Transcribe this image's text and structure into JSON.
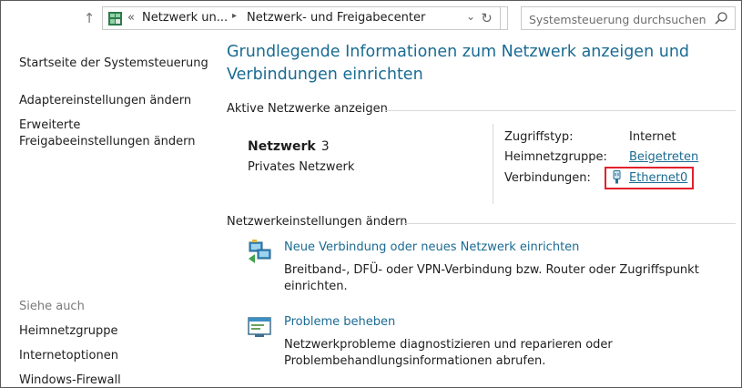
{
  "window": {
    "title": "Netzwerk- und Freigabecenter"
  },
  "nav": {
    "up_glyph": "↑"
  },
  "address_bar": {
    "overflow": "«",
    "crumbs": [
      "Netzwerk un...",
      "Netzwerk- und Freigabecenter"
    ],
    "separator": "▸",
    "dropdown_glyph": "⌄",
    "refresh_glyph": "↻"
  },
  "search": {
    "placeholder": "Systemsteuerung durchsuchen"
  },
  "sidebar": {
    "home": "Startseite der Systemsteuerung",
    "adapter": "Adaptereinstellungen ändern",
    "advanced_line1": "Erweiterte",
    "advanced_line2": "Freigabeeinstellungen ändern",
    "see_also": "Siehe auch",
    "links": [
      "Heimnetzgruppe",
      "Internetoptionen",
      "Windows-Firewall"
    ]
  },
  "main": {
    "title_line1": "Grundlegende Informationen zum Netzwerk anzeigen und",
    "title_line2": "Verbindungen einrichten",
    "active_networks_header": "Aktive Netzwerke anzeigen",
    "network": {
      "name": "Netzwerk",
      "number": "3",
      "type": "Privates Netzwerk",
      "access_type_label": "Zugriffstyp:",
      "access_type_value": "Internet",
      "homegroup_label": "Heimnetzgruppe:",
      "homegroup_value": "Beigetreten",
      "connections_label": "Verbindungen:",
      "connections_value": "Ethernet0"
    },
    "change_settings_header": "Netzwerkeinstellungen ändern",
    "tasks": [
      {
        "link": "Neue Verbindung oder neues Netzwerk einrichten",
        "desc_line1": "Breitband-, DFÜ- oder VPN-Verbindung bzw. Router oder Zugriffspunkt",
        "desc_line2": "einrichten."
      },
      {
        "link": "Probleme beheben",
        "desc_line1": "Netzwerkprobleme diagnostizieren und reparieren oder",
        "desc_line2": "Problembehandlungsinformationen abrufen."
      }
    ]
  },
  "colors": {
    "link": "#1a6b92",
    "highlight_border": "#e2202b",
    "divider": "#d9d9d9"
  }
}
